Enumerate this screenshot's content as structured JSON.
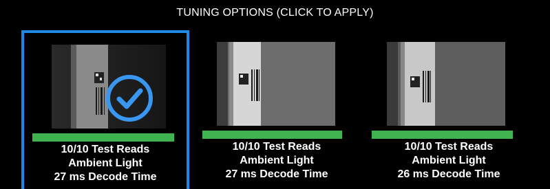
{
  "header": {
    "title": "TUNING OPTIONS (CLICK TO APPLY)"
  },
  "options": [
    {
      "reads": "10/10 Test Reads",
      "light": "Ambient Light",
      "decode": "27 ms Decode Time",
      "selected": true
    },
    {
      "reads": "10/10 Test Reads",
      "light": "Ambient Light",
      "decode": "27 ms Decode Time",
      "selected": false
    },
    {
      "reads": "10/10 Test Reads",
      "light": "Ambient Light",
      "decode": "26 ms Decode Time",
      "selected": false
    }
  ],
  "colors": {
    "selected_border": "#1e88e5",
    "status_bar": "#3fb34f",
    "check": "#3a97f0"
  },
  "icons": {
    "selected_indicator": "checkmark-circle-icon"
  }
}
